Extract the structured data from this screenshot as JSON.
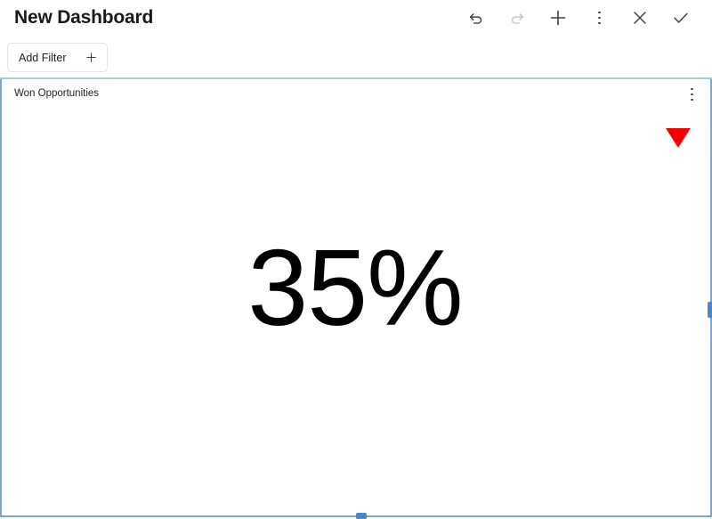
{
  "header": {
    "title": "New Dashboard",
    "toolbar": [
      {
        "name": "undo-icon",
        "label": "Undo",
        "state": "enabled"
      },
      {
        "name": "redo-icon",
        "label": "Redo",
        "state": "disabled"
      },
      {
        "name": "plus-icon",
        "label": "Add",
        "state": "enabled"
      },
      {
        "name": "kebab-menu-icon",
        "label": "More options",
        "state": "enabled"
      },
      {
        "name": "close-icon",
        "label": "Close",
        "state": "enabled"
      },
      {
        "name": "check-icon",
        "label": "Save",
        "state": "enabled"
      }
    ]
  },
  "filter_bar": {
    "add_filter_label": "Add Filter",
    "add_filter_icon": "plus-icon"
  },
  "card": {
    "title": "Won Opportunities",
    "menu_icon": "kebab-menu-icon",
    "trend": {
      "icon": "triangle-down-icon",
      "direction": "down",
      "color": "#f40000"
    },
    "kpi_value": "35%",
    "selected": true,
    "border_color": "#7ba7d0",
    "handle_color": "#4a86c5"
  }
}
